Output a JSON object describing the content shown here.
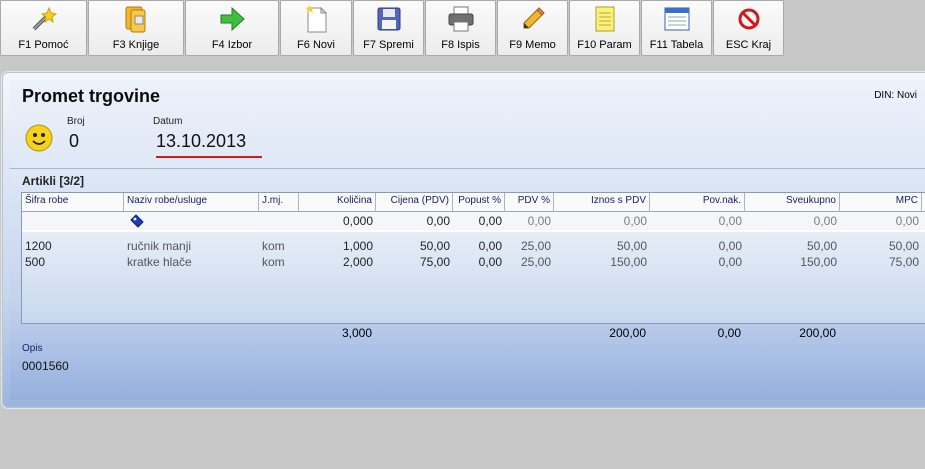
{
  "toolbar": [
    {
      "key": "f1",
      "label": "F1 Pomoć",
      "icon": "wand-icon"
    },
    {
      "key": "f3",
      "label": "F3 Knjige",
      "icon": "books-icon"
    },
    {
      "key": "f4",
      "label": "F4 Izbor",
      "icon": "green-arrow-icon"
    },
    {
      "key": "f6",
      "label": "F6 Novi",
      "icon": "new-document-icon"
    },
    {
      "key": "f7",
      "label": "F7 Spremi",
      "icon": "floppy-disk-icon"
    },
    {
      "key": "f8",
      "label": "F8 Ispis",
      "icon": "printer-icon"
    },
    {
      "key": "f9",
      "label": "F9 Memo",
      "icon": "pencil-icon"
    },
    {
      "key": "f10",
      "label": "F10 Param",
      "icon": "notepad-icon"
    },
    {
      "key": "f11",
      "label": "F11 Tabela",
      "icon": "table-window-icon"
    },
    {
      "key": "esc",
      "label": "ESC Kraj",
      "icon": "stop-icon"
    }
  ],
  "header": {
    "title": "Promet trgovine",
    "currency_status": "DIN: Novi",
    "broj_label": "Broj",
    "broj_value": "0",
    "datum_label": "Datum",
    "datum_value": "13.10.2013"
  },
  "articles": {
    "section_label": "Artikli  [3/2]",
    "columns": [
      "Šifra robe",
      "Naziv robe/usluge",
      "J.mj.",
      "Količina",
      "Cijena (PDV)",
      "Popust %",
      "PDV %",
      "Iznos s PDV",
      "Pov.nak.",
      "Sveukupno",
      "MPC"
    ],
    "input_row": {
      "kolicina": "0,000",
      "cijena": "0,00",
      "popust": "0,00",
      "pdv": "0,00",
      "iznos": "0,00",
      "povnak": "0,00",
      "sveukupno": "0,00",
      "mpc": "0,00"
    },
    "rows": [
      {
        "sifra": "1200",
        "naziv": "ručnik manji",
        "jmj": "kom",
        "kolicina": "1,000",
        "cijena": "50,00",
        "popust": "0,00",
        "pdv": "25,00",
        "iznos": "50,00",
        "povnak": "0,00",
        "sveukupno": "50,00",
        "mpc": "50,00"
      },
      {
        "sifra": "500",
        "naziv": "kratke hlače",
        "jmj": "kom",
        "kolicina": "2,000",
        "cijena": "75,00",
        "popust": "0,00",
        "pdv": "25,00",
        "iznos": "150,00",
        "povnak": "0,00",
        "sveukupno": "150,00",
        "mpc": "75,00"
      }
    ],
    "totals": {
      "kolicina": "3,000",
      "iznos": "200,00",
      "povnak": "0,00",
      "sveukupno": "200,00"
    }
  },
  "opis": {
    "label": "Opis",
    "value": "0001560"
  }
}
